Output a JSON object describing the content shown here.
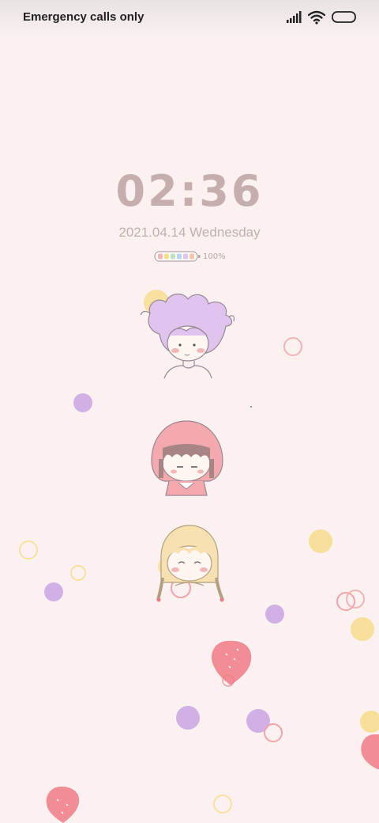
{
  "status_bar": {
    "carrier_text": "Emergency calls only",
    "icons": [
      "signal-icon",
      "wifi-icon",
      "battery-icon"
    ]
  },
  "lockscreen": {
    "time": "02:36",
    "date": "2021.04.14 Wednesday",
    "battery_percent_label": "100%",
    "battery_level": 1.0
  },
  "wallpaper": {
    "characters": [
      "girl-purple-hair",
      "girl-red-hood",
      "girl-blonde-braids"
    ],
    "decor": [
      "bubble",
      "strawberry"
    ]
  },
  "colors": {
    "background": "#fbf1f1",
    "clock": "#c7aeae",
    "date": "#c2b0b0",
    "strawberry": "#f07a85",
    "bubble_yellow": "#f7dc8a",
    "bubble_purple": "#c9a5e3"
  }
}
